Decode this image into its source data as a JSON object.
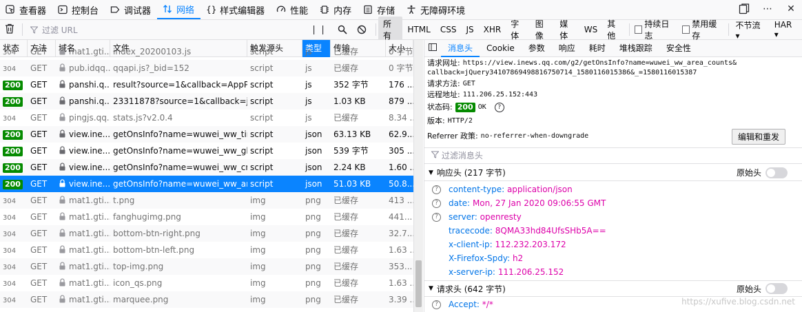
{
  "toolbox": {
    "tabs": [
      {
        "label": "查看器",
        "icon": "inspector-icon"
      },
      {
        "label": "控制台",
        "icon": "console-icon"
      },
      {
        "label": "调试器",
        "icon": "debugger-icon"
      },
      {
        "label": "网络",
        "icon": "network-icon",
        "active": true
      },
      {
        "label": "样式编辑器",
        "icon": "style-editor-icon"
      },
      {
        "label": "性能",
        "icon": "performance-icon"
      },
      {
        "label": "内存",
        "icon": "memory-icon"
      },
      {
        "label": "存储",
        "icon": "storage-icon"
      },
      {
        "label": "无障碍环境",
        "icon": "accessibility-icon"
      }
    ]
  },
  "filterbar": {
    "filter_placeholder": "过滤 URL",
    "types": [
      "所有",
      "HTML",
      "CSS",
      "JS",
      "XHR",
      "字体",
      "图像",
      "媒体",
      "WS",
      "其他"
    ],
    "persist_label": "持续日志",
    "disable_cache_label": "禁用缓存",
    "throttle_label": "不节流 ▾",
    "har_label": "HAR ▾"
  },
  "table": {
    "headers": {
      "status": "状态",
      "method": "方法",
      "domain": "域名",
      "file": "文件",
      "cause": "触发源头",
      "type": "类型",
      "transfer": "传输",
      "size": "大小"
    },
    "rows": [
      {
        "status": "304",
        "method": "GET",
        "domain": "mat1.gti...",
        "file": "index_20200103.js",
        "cause": "script",
        "type": "js",
        "transfer": "已缓存",
        "size": "0 字节",
        "cached": true
      },
      {
        "status": "304",
        "method": "GET",
        "domain": "pub.idqq...",
        "file": "qqapi.js?_bid=152",
        "cause": "script",
        "type": "js",
        "transfer": "已缓存",
        "size": "0 字节",
        "cached": true
      },
      {
        "status": "200",
        "method": "GET",
        "domain": "panshi.q...",
        "file": "result?source=1&callback=AppPlat...",
        "cause": "script",
        "type": "js",
        "transfer": "352 字节",
        "size": "176 ...",
        "cached": false
      },
      {
        "status": "200",
        "method": "GET",
        "domain": "panshi.q...",
        "file": "23311878?source=1&callback=jQu...",
        "cause": "script",
        "type": "js",
        "transfer": "1.03 KB",
        "size": "879 ...",
        "cached": false
      },
      {
        "status": "304",
        "method": "GET",
        "domain": "pingjs.qq...",
        "file": "stats.js?v2.0.4",
        "cause": "script",
        "type": "js",
        "transfer": "已缓存",
        "size": "8.34 ...",
        "cached": true
      },
      {
        "status": "200",
        "method": "GET",
        "domain": "view.ine...",
        "file": "getOnsInfo?name=wuwei_ww_time...",
        "cause": "script",
        "type": "json",
        "transfer": "63.13 KB",
        "size": "62.9...",
        "cached": false
      },
      {
        "status": "200",
        "method": "GET",
        "domain": "view.ine...",
        "file": "getOnsInfo?name=wuwei_ww_glo...",
        "cause": "script",
        "type": "json",
        "transfer": "539 字节",
        "size": "305 ...",
        "cached": false
      },
      {
        "status": "200",
        "method": "GET",
        "domain": "view.ine...",
        "file": "getOnsInfo?name=wuwei_ww_cn_...",
        "cause": "script",
        "type": "json",
        "transfer": "2.24 KB",
        "size": "1.60 ...",
        "cached": false
      },
      {
        "status": "200",
        "method": "GET",
        "domain": "view.ine...",
        "file": "getOnsInfo?name=wuwei_ww_area...",
        "cause": "script",
        "type": "json",
        "transfer": "51.03 KB",
        "size": "50.8...",
        "cached": false,
        "selected": true
      },
      {
        "status": "304",
        "method": "GET",
        "domain": "mat1.gti...",
        "file": "t.png",
        "cause": "img",
        "type": "png",
        "transfer": "已缓存",
        "size": "413 ...",
        "cached": true
      },
      {
        "status": "304",
        "method": "GET",
        "domain": "mat1.gti...",
        "file": "fanghugimg.png",
        "cause": "img",
        "type": "png",
        "transfer": "已缓存",
        "size": "441...",
        "cached": true
      },
      {
        "status": "304",
        "method": "GET",
        "domain": "mat1.gti...",
        "file": "bottom-btn-right.png",
        "cause": "img",
        "type": "png",
        "transfer": "已缓存",
        "size": "32.7...",
        "cached": true
      },
      {
        "status": "304",
        "method": "GET",
        "domain": "mat1.gti...",
        "file": "bottom-btn-left.png",
        "cause": "img",
        "type": "png",
        "transfer": "已缓存",
        "size": "1.63 ...",
        "cached": true
      },
      {
        "status": "304",
        "method": "GET",
        "domain": "mat1.gti...",
        "file": "top-img.png",
        "cause": "img",
        "type": "png",
        "transfer": "已缓存",
        "size": "353...",
        "cached": true
      },
      {
        "status": "304",
        "method": "GET",
        "domain": "mat1.gti...",
        "file": "icon_qs.png",
        "cause": "img",
        "type": "png",
        "transfer": "已缓存",
        "size": "1.63 ...",
        "cached": true
      },
      {
        "status": "304",
        "method": "GET",
        "domain": "mat1.gti...",
        "file": "marquee.png",
        "cause": "img",
        "type": "png",
        "transfer": "已缓存",
        "size": "3.39 ...",
        "cached": true
      }
    ]
  },
  "details": {
    "tabs": [
      "消息头",
      "Cookie",
      "参数",
      "响应",
      "耗时",
      "堆栈跟踪",
      "安全性"
    ],
    "request_url_label": "请求网址:",
    "request_url_line1": "https://view.inews.qq.com/g2/getOnsInfo?name=wuwei_ww_area_counts&",
    "request_url_line2": "callback=jQuery34107869498816750714_1580116015386&_=1580116015387",
    "method_label": "请求方法:",
    "method_value": "GET",
    "remote_label": "远程地址:",
    "remote_value": "111.206.25.152:443",
    "status_label": "状态码:",
    "status_code": "200",
    "status_text": "OK",
    "version_label": "版本:",
    "version_value": "HTTP/2",
    "referrer_label": "Referrer 政策:",
    "referrer_value": "no-referrer-when-downgrade",
    "resend_label": "编辑和重发",
    "filter_placeholder": "过滤消息头",
    "response_headers_title": "响应头 (217 字节)",
    "request_headers_title": "请求头 (642 字节)",
    "raw_label": "原始头",
    "response_headers": [
      {
        "name": "content-type:",
        "value": "application/json",
        "help": true
      },
      {
        "name": "date:",
        "value": "Mon, 27 Jan 2020 09:06:55 GMT",
        "help": true
      },
      {
        "name": "server:",
        "value": "openresty",
        "help": true
      },
      {
        "name": "tracecode:",
        "value": "8QMA33hd84UfsSHb5A==",
        "help": false
      },
      {
        "name": "x-client-ip:",
        "value": "112.232.203.172",
        "help": false
      },
      {
        "name": "X-Firefox-Spdy:",
        "value": "h2",
        "help": false
      },
      {
        "name": "x-server-ip:",
        "value": "111.206.25.152",
        "help": false
      }
    ],
    "request_headers": [
      {
        "name": "Accept:",
        "value": "*/*",
        "help": true
      }
    ]
  },
  "watermark": "https://xufive.blog.csdn.net"
}
